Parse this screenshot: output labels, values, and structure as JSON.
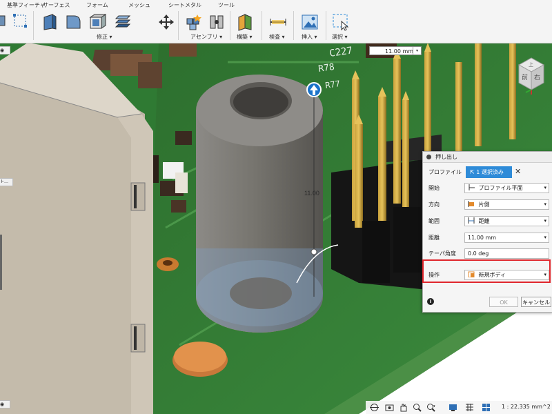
{
  "toolbar": {
    "tabs": [
      "基準フィーチャ",
      "サーフェス",
      "フォーム",
      "メッシュ",
      "シートメタル",
      "ツール"
    ],
    "groups": [
      "修正",
      "アセンブリ",
      "構築",
      "検査",
      "挿入",
      "選択"
    ]
  },
  "viewport": {
    "distance_input": "11.00 mm",
    "dimension_label": "11.00",
    "pcb_labels": [
      "C227",
      "R78",
      "R77"
    ],
    "left_tab_text": "ト…",
    "viewcube_faces": [
      "前",
      "右",
      "上"
    ]
  },
  "extrude_dialog": {
    "title": "押し出し",
    "rows": [
      {
        "label": "プロファイル",
        "value": "1 選択済み",
        "kind": "selection"
      },
      {
        "label": "開始",
        "value": "プロファイル平面",
        "kind": "select",
        "icon": "profile-plane-icon"
      },
      {
        "label": "方向",
        "value": "片側",
        "kind": "select",
        "icon": "one-side-icon"
      },
      {
        "label": "範囲",
        "value": "距離",
        "kind": "select",
        "icon": "distance-icon"
      },
      {
        "label": "距離",
        "value": "11.00 mm",
        "kind": "input"
      },
      {
        "label": "テーパ角度",
        "value": "0.0 deg",
        "kind": "input"
      },
      {
        "label": "操作",
        "value": "新規ボディ",
        "kind": "select",
        "icon": "new-body-icon"
      }
    ],
    "ok_label": "OK",
    "cancel_label": "キャンセル",
    "highlight_color": "#e0262c"
  },
  "status": {
    "area_text": "1 : 22.335 mm^2"
  },
  "colors": {
    "accent": "#2e8bd8",
    "pcb_green": "#2f7a33",
    "standoff": "#7d7b78"
  }
}
